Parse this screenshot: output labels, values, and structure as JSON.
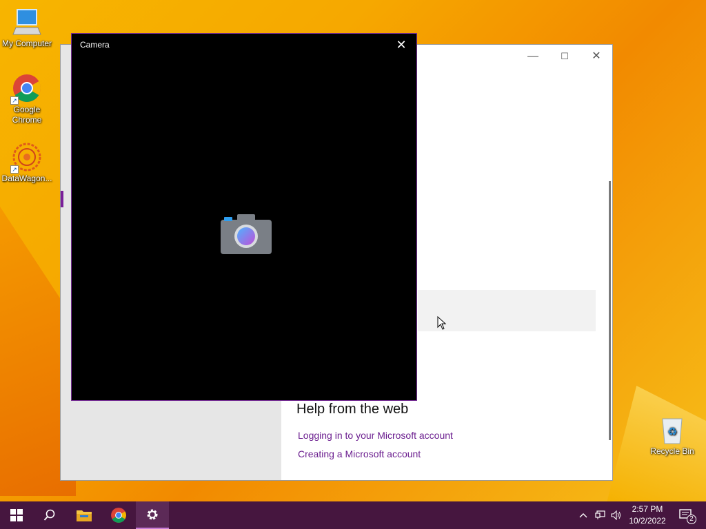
{
  "desktop": {
    "icons": [
      {
        "label": "My Computer",
        "icon": "computer-icon"
      },
      {
        "label": "Google Chrome",
        "icon": "chrome-icon"
      },
      {
        "label": "DataWagon...",
        "icon": "datawagon-icon"
      },
      {
        "label": "Recycle Bin",
        "icon": "recycle-bin-icon"
      }
    ]
  },
  "settings_window": {
    "help_title": "Help from the web",
    "links": [
      "Logging in to your Microsoft account",
      "Creating a Microsoft account"
    ],
    "controls": {
      "minimize": "—",
      "maximize": "☐",
      "close": "✕"
    }
  },
  "camera_window": {
    "title": "Camera",
    "close": "✕"
  },
  "taskbar": {
    "buttons": [
      "start-icon",
      "search-icon",
      "file-explorer-icon",
      "chrome-icon",
      "settings-icon"
    ],
    "active": "settings-icon",
    "time": "2:57 PM",
    "date": "10/2/2022",
    "notification_count": "2",
    "accent_color": "#46163f"
  }
}
